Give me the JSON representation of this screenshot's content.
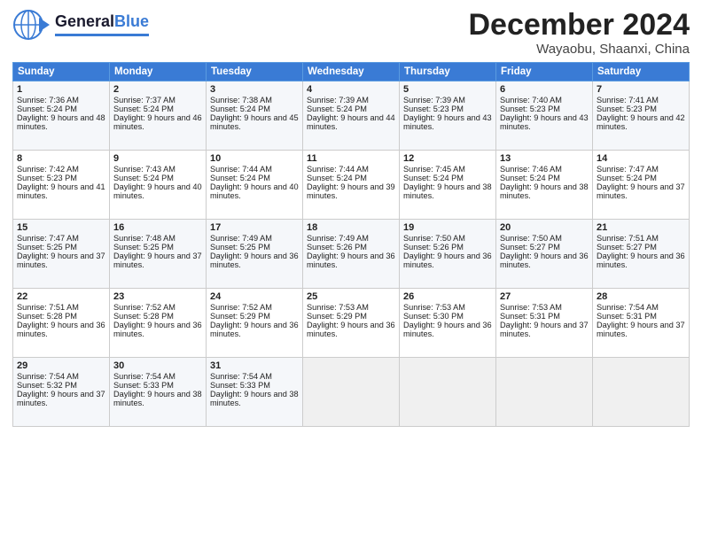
{
  "header": {
    "logo_general": "General",
    "logo_blue": "Blue",
    "month": "December 2024",
    "location": "Wayaobu, Shaanxi, China"
  },
  "weekdays": [
    "Sunday",
    "Monday",
    "Tuesday",
    "Wednesday",
    "Thursday",
    "Friday",
    "Saturday"
  ],
  "weeks": [
    [
      {
        "day": "1",
        "sunrise": "Sunrise: 7:36 AM",
        "sunset": "Sunset: 5:24 PM",
        "daylight": "Daylight: 9 hours and 48 minutes."
      },
      {
        "day": "2",
        "sunrise": "Sunrise: 7:37 AM",
        "sunset": "Sunset: 5:24 PM",
        "daylight": "Daylight: 9 hours and 46 minutes."
      },
      {
        "day": "3",
        "sunrise": "Sunrise: 7:38 AM",
        "sunset": "Sunset: 5:24 PM",
        "daylight": "Daylight: 9 hours and 45 minutes."
      },
      {
        "day": "4",
        "sunrise": "Sunrise: 7:39 AM",
        "sunset": "Sunset: 5:24 PM",
        "daylight": "Daylight: 9 hours and 44 minutes."
      },
      {
        "day": "5",
        "sunrise": "Sunrise: 7:39 AM",
        "sunset": "Sunset: 5:23 PM",
        "daylight": "Daylight: 9 hours and 43 minutes."
      },
      {
        "day": "6",
        "sunrise": "Sunrise: 7:40 AM",
        "sunset": "Sunset: 5:23 PM",
        "daylight": "Daylight: 9 hours and 43 minutes."
      },
      {
        "day": "7",
        "sunrise": "Sunrise: 7:41 AM",
        "sunset": "Sunset: 5:23 PM",
        "daylight": "Daylight: 9 hours and 42 minutes."
      }
    ],
    [
      {
        "day": "8",
        "sunrise": "Sunrise: 7:42 AM",
        "sunset": "Sunset: 5:23 PM",
        "daylight": "Daylight: 9 hours and 41 minutes."
      },
      {
        "day": "9",
        "sunrise": "Sunrise: 7:43 AM",
        "sunset": "Sunset: 5:24 PM",
        "daylight": "Daylight: 9 hours and 40 minutes."
      },
      {
        "day": "10",
        "sunrise": "Sunrise: 7:44 AM",
        "sunset": "Sunset: 5:24 PM",
        "daylight": "Daylight: 9 hours and 40 minutes."
      },
      {
        "day": "11",
        "sunrise": "Sunrise: 7:44 AM",
        "sunset": "Sunset: 5:24 PM",
        "daylight": "Daylight: 9 hours and 39 minutes."
      },
      {
        "day": "12",
        "sunrise": "Sunrise: 7:45 AM",
        "sunset": "Sunset: 5:24 PM",
        "daylight": "Daylight: 9 hours and 38 minutes."
      },
      {
        "day": "13",
        "sunrise": "Sunrise: 7:46 AM",
        "sunset": "Sunset: 5:24 PM",
        "daylight": "Daylight: 9 hours and 38 minutes."
      },
      {
        "day": "14",
        "sunrise": "Sunrise: 7:47 AM",
        "sunset": "Sunset: 5:24 PM",
        "daylight": "Daylight: 9 hours and 37 minutes."
      }
    ],
    [
      {
        "day": "15",
        "sunrise": "Sunrise: 7:47 AM",
        "sunset": "Sunset: 5:25 PM",
        "daylight": "Daylight: 9 hours and 37 minutes."
      },
      {
        "day": "16",
        "sunrise": "Sunrise: 7:48 AM",
        "sunset": "Sunset: 5:25 PM",
        "daylight": "Daylight: 9 hours and 37 minutes."
      },
      {
        "day": "17",
        "sunrise": "Sunrise: 7:49 AM",
        "sunset": "Sunset: 5:25 PM",
        "daylight": "Daylight: 9 hours and 36 minutes."
      },
      {
        "day": "18",
        "sunrise": "Sunrise: 7:49 AM",
        "sunset": "Sunset: 5:26 PM",
        "daylight": "Daylight: 9 hours and 36 minutes."
      },
      {
        "day": "19",
        "sunrise": "Sunrise: 7:50 AM",
        "sunset": "Sunset: 5:26 PM",
        "daylight": "Daylight: 9 hours and 36 minutes."
      },
      {
        "day": "20",
        "sunrise": "Sunrise: 7:50 AM",
        "sunset": "Sunset: 5:27 PM",
        "daylight": "Daylight: 9 hours and 36 minutes."
      },
      {
        "day": "21",
        "sunrise": "Sunrise: 7:51 AM",
        "sunset": "Sunset: 5:27 PM",
        "daylight": "Daylight: 9 hours and 36 minutes."
      }
    ],
    [
      {
        "day": "22",
        "sunrise": "Sunrise: 7:51 AM",
        "sunset": "Sunset: 5:28 PM",
        "daylight": "Daylight: 9 hours and 36 minutes."
      },
      {
        "day": "23",
        "sunrise": "Sunrise: 7:52 AM",
        "sunset": "Sunset: 5:28 PM",
        "daylight": "Daylight: 9 hours and 36 minutes."
      },
      {
        "day": "24",
        "sunrise": "Sunrise: 7:52 AM",
        "sunset": "Sunset: 5:29 PM",
        "daylight": "Daylight: 9 hours and 36 minutes."
      },
      {
        "day": "25",
        "sunrise": "Sunrise: 7:53 AM",
        "sunset": "Sunset: 5:29 PM",
        "daylight": "Daylight: 9 hours and 36 minutes."
      },
      {
        "day": "26",
        "sunrise": "Sunrise: 7:53 AM",
        "sunset": "Sunset: 5:30 PM",
        "daylight": "Daylight: 9 hours and 36 minutes."
      },
      {
        "day": "27",
        "sunrise": "Sunrise: 7:53 AM",
        "sunset": "Sunset: 5:31 PM",
        "daylight": "Daylight: 9 hours and 37 minutes."
      },
      {
        "day": "28",
        "sunrise": "Sunrise: 7:54 AM",
        "sunset": "Sunset: 5:31 PM",
        "daylight": "Daylight: 9 hours and 37 minutes."
      }
    ],
    [
      {
        "day": "29",
        "sunrise": "Sunrise: 7:54 AM",
        "sunset": "Sunset: 5:32 PM",
        "daylight": "Daylight: 9 hours and 37 minutes."
      },
      {
        "day": "30",
        "sunrise": "Sunrise: 7:54 AM",
        "sunset": "Sunset: 5:33 PM",
        "daylight": "Daylight: 9 hours and 38 minutes."
      },
      {
        "day": "31",
        "sunrise": "Sunrise: 7:54 AM",
        "sunset": "Sunset: 5:33 PM",
        "daylight": "Daylight: 9 hours and 38 minutes."
      },
      null,
      null,
      null,
      null
    ]
  ]
}
